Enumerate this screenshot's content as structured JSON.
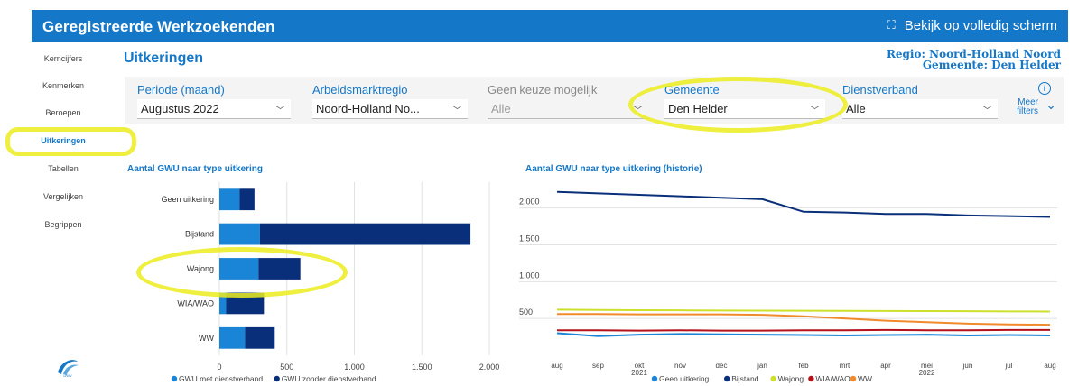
{
  "header": {
    "title": "Geregistreerde Werkzoekenden",
    "fullscreen_label": "Bekijk op volledig scherm"
  },
  "sidebar": {
    "items": [
      {
        "label": "Kerncijfers"
      },
      {
        "label": "Kenmerken"
      },
      {
        "label": "Beroepen"
      },
      {
        "label": "Uitkeringen"
      },
      {
        "label": "Tabellen"
      },
      {
        "label": "Vergelijken"
      },
      {
        "label": "Begrippen"
      }
    ],
    "active": "Uitkeringen",
    "logo_text": "UWV"
  },
  "page": {
    "title": "Uitkeringen",
    "region_line1": "Regio: Noord-Holland Noord",
    "region_line2": "Gemeente: Den Helder"
  },
  "filters": [
    {
      "label": "Periode (maand)",
      "value": "Augustus 2022",
      "disabled": false
    },
    {
      "label": "Arbeidsmarktregio",
      "value": "Noord-Holland No...",
      "disabled": false
    },
    {
      "label": "Geen keuze mogelijk",
      "value": "Alle",
      "disabled": true
    },
    {
      "label": "Gemeente",
      "value": "Den Helder",
      "disabled": false
    },
    {
      "label": "Dienstverband",
      "value": "Alle",
      "disabled": false
    }
  ],
  "more_filters": {
    "line1": "Meer",
    "line2": "filters"
  },
  "colors": {
    "brand": "#1577c7",
    "dark": "#0a2f7a",
    "light": "#1a84d6",
    "wajong": "#cde02c",
    "wia": "#b5121b",
    "ww": "#f08a2a",
    "highlight": "#ecec1f"
  },
  "chart_data": [
    {
      "type": "bar",
      "orientation": "horizontal",
      "stacked": true,
      "title": "Aantal GWU naar type uitkering",
      "categories": [
        "Geen uitkering",
        "Bijstand",
        "Wajong",
        "WIA/WAO",
        "WW"
      ],
      "series": [
        {
          "name": "GWU met dienstverband",
          "values": [
            150,
            300,
            290,
            50,
            190
          ]
        },
        {
          "name": "GWU zonder dienstverband",
          "values": [
            110,
            1560,
            310,
            280,
            220
          ]
        }
      ],
      "xlim": [
        0,
        2000
      ],
      "xticks": [
        "0",
        "500",
        "1.000",
        "1.500",
        "2.000"
      ],
      "grid": true,
      "legend": "bottom"
    },
    {
      "type": "line",
      "title": "Aantal GWU naar type uitkering (historie)",
      "x": [
        "aug",
        "sep",
        "okt",
        "nov",
        "dec",
        "jan",
        "feb",
        "mrt",
        "apr",
        "mei",
        "jun",
        "jul",
        "aug"
      ],
      "x_year_labels": [
        {
          "at": "okt",
          "label": "2021"
        },
        {
          "at": "mei",
          "label": "2022"
        }
      ],
      "series": [
        {
          "name": "Geen uitkering",
          "values": [
            300,
            260,
            280,
            290,
            285,
            280,
            275,
            270,
            275,
            280,
            270,
            275,
            270
          ]
        },
        {
          "name": "Bijstand",
          "values": [
            2220,
            2200,
            2180,
            2160,
            2140,
            2120,
            1950,
            1940,
            1920,
            1920,
            1900,
            1890,
            1880
          ]
        },
        {
          "name": "Wajong",
          "values": [
            620,
            615,
            612,
            610,
            608,
            606,
            605,
            603,
            602,
            600,
            598,
            596,
            594
          ]
        },
        {
          "name": "WIA/WAO",
          "values": [
            340,
            340,
            335,
            340,
            335,
            335,
            340,
            340,
            345,
            340,
            340,
            345,
            345
          ]
        },
        {
          "name": "WW",
          "values": [
            560,
            560,
            555,
            555,
            555,
            550,
            530,
            500,
            470,
            450,
            430,
            420,
            415
          ]
        }
      ],
      "ylim": [
        0,
        2400
      ],
      "yticks": [
        "500",
        "1.000",
        "1.500",
        "2.000"
      ],
      "grid": true,
      "legend": "bottom"
    }
  ]
}
